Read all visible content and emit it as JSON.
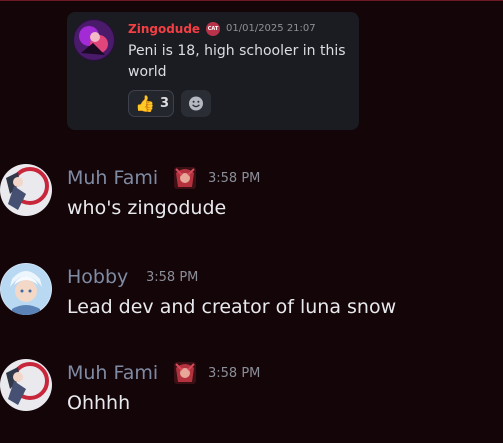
{
  "embed": {
    "author": "Zingodude",
    "author_color": "#f23f43",
    "badge_text": "CAT",
    "timestamp": "01/01/2025 21:07",
    "text": "Peni is 18, high schooler in this world",
    "reaction": {
      "emoji": "👍",
      "emoji_icon": "thumbs-up-icon",
      "count": "3"
    },
    "add_reaction_icon": "smiley-add-reaction-icon"
  },
  "messages": [
    {
      "author": "Muh Fami",
      "time": "3:58 PM",
      "text": "who's zingodude",
      "role_icon": "character-emoji-icon"
    },
    {
      "author": "Hobby",
      "time": "3:58 PM",
      "text": "Lead dev and creator of luna snow"
    },
    {
      "author": "Muh Fami",
      "time": "3:58 PM",
      "text": "Ohhhh",
      "role_icon": "character-emoji-icon"
    }
  ],
  "colors": {
    "background": "#140509",
    "username": "#7f8ba3",
    "message_text": "#e8e9ec",
    "card": "#1b1c22"
  }
}
